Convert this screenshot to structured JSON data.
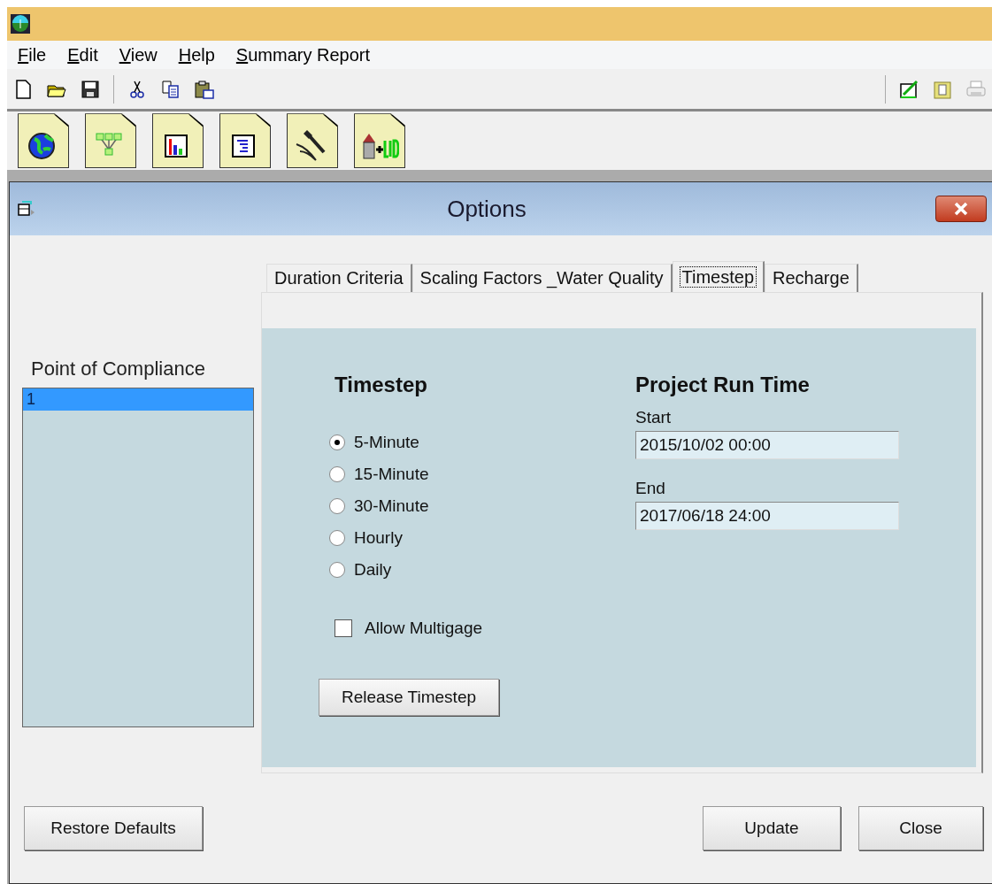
{
  "menu": [
    "File",
    "Edit",
    "View",
    "Help",
    "Summary Report"
  ],
  "dialog": {
    "title": "Options",
    "list_label": "Point of Compliance",
    "list_items": [
      {
        "label": "1",
        "selected": true
      }
    ],
    "tabs": [
      {
        "label": "Duration Criteria",
        "selected": false
      },
      {
        "label": "Scaling Factors _Water Quality",
        "selected": false
      },
      {
        "label": "Timestep",
        "selected": true
      },
      {
        "label": "Recharge",
        "selected": false
      }
    ],
    "timestep_heading": "Timestep",
    "timestep_options": [
      {
        "label": "5-Minute",
        "selected": true
      },
      {
        "label": "15-Minute",
        "selected": false
      },
      {
        "label": "30-Minute",
        "selected": false
      },
      {
        "label": "Hourly",
        "selected": false
      },
      {
        "label": "Daily",
        "selected": false
      }
    ],
    "allow_multigage": {
      "label": "Allow Multigage",
      "checked": false
    },
    "release_button": "Release Timestep",
    "run_time_heading": "Project Run Time",
    "start_label": "Start",
    "start_value": "2015/10/02 00:00",
    "end_label": "End",
    "end_value": "2017/06/18 24:00",
    "buttons": [
      "Restore Defaults",
      "Update",
      "Close"
    ]
  }
}
